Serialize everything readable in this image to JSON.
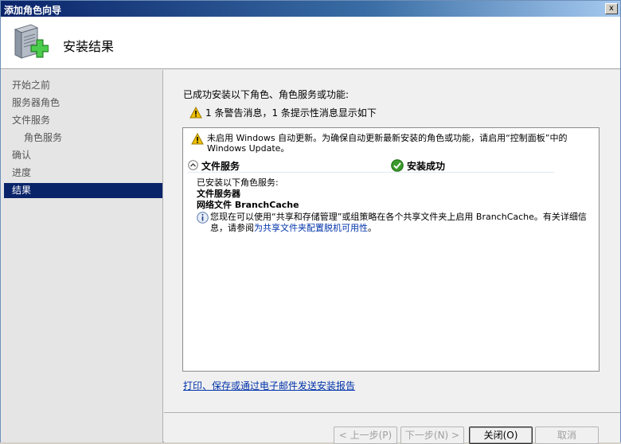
{
  "window": {
    "title": "添加角色向导",
    "close_glyph": "x"
  },
  "header": {
    "title": "安装结果",
    "icon": "server-add-icon"
  },
  "sidebar": {
    "items": [
      {
        "label": "开始之前",
        "sub": false,
        "active": false
      },
      {
        "label": "服务器角色",
        "sub": false,
        "active": false
      },
      {
        "label": "文件服务",
        "sub": false,
        "active": false
      },
      {
        "label": "角色服务",
        "sub": true,
        "active": false
      },
      {
        "label": "确认",
        "sub": false,
        "active": false
      },
      {
        "label": "进度",
        "sub": false,
        "active": false
      },
      {
        "label": "结果",
        "sub": false,
        "active": true
      }
    ]
  },
  "main": {
    "intro": "已成功安装以下角色、角色服务或功能:",
    "warning_summary": "1 条警告消息，1 条提示性消息显示如下",
    "results": {
      "warning_text": "未启用 Windows 自动更新。为确保自动更新最新安装的角色或功能，请启用“控制面板”中的 Windows Update。",
      "section_name": "文件服务",
      "section_status": "安装成功",
      "installed_label": "已安装以下角色服务:",
      "installed_items": [
        "文件服务器",
        "网络文件 BranchCache"
      ],
      "info_text": "您现在可以使用“共享和存储管理”或组策略在各个共享文件夹上启用 BranchCache。有关详细信息，请参阅",
      "info_link": "为共享文件夹配置脱机可用性",
      "info_end": "。"
    },
    "report_link": "打印、保存或通过电子邮件发送安装报告"
  },
  "buttons": {
    "prev": "< 上一步(P)",
    "next": "下一步(N) >",
    "close": "关闭(O)",
    "cancel": "取消"
  },
  "colors": {
    "selection": "#0a246a",
    "link": "#0033aa",
    "success": "#3a9a2a",
    "warning": "#f0c000"
  }
}
